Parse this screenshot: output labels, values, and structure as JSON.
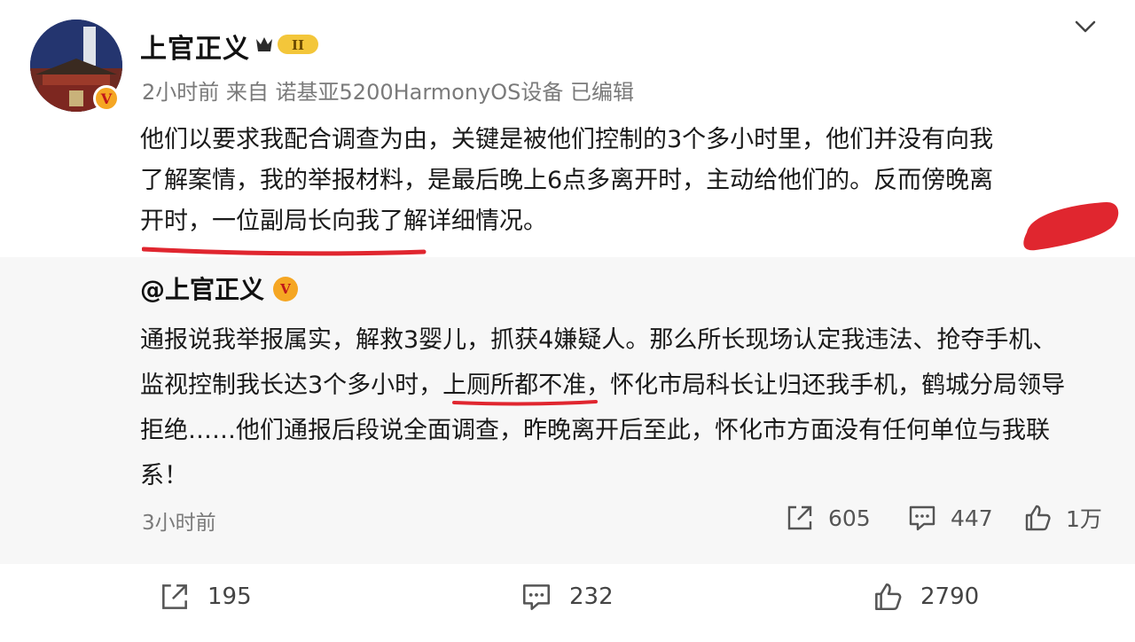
{
  "post": {
    "author": "上官正义",
    "level_badge": "II",
    "meta": "2小时前  来自 诺基亚5200HarmonyOS设备  已编辑",
    "lines": [
      "他们以要求我配合调查为由，关键是被他们控制的3个多小时里，他们并没有向我",
      "了解案情，我的举报材料，是最后晚上6点多离开时，主动给他们的。反而傍晚离",
      "开时，一位副局长向我了解详细情况。"
    ]
  },
  "quote": {
    "author": "@上官正义",
    "lines": [
      "通报说我举报属实，解救3婴儿，抓获4嫌疑人。那么所长现场认定我违法、抢夺手机、",
      "监视控制我长达3个多小时，上厕所都不准，怀化市局科长让归还我手机，鹤城分局领导",
      "拒绝……他们通报后段说全面调查，昨晚离开后至此，怀化市方面没有任何单位与我联",
      "系！"
    ],
    "time": "3小时前",
    "shares": "605",
    "comments": "447",
    "likes": "1万"
  },
  "actions": {
    "shares": "195",
    "comments": "232",
    "likes": "2790"
  },
  "colors": {
    "annotation_red": "#e0262f",
    "verified_gold": "#f5a623",
    "quote_bg": "#f7f7f7"
  },
  "icons": [
    "chevron-down-icon",
    "verified-icon",
    "level-badge-icon",
    "share-icon",
    "comment-icon",
    "like-icon"
  ]
}
